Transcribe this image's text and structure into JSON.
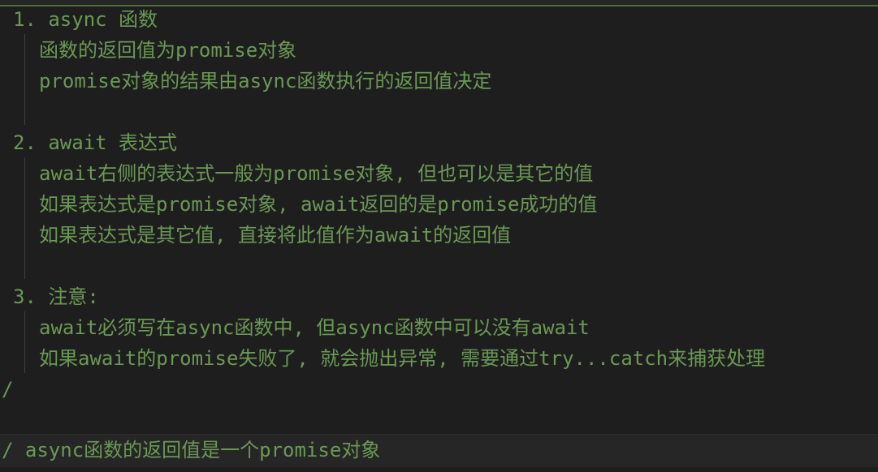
{
  "code": {
    "lines": [
      "1. async 函数",
      "函数的返回值为promise对象",
      "promise对象的结果由async函数执行的返回值决定",
      "2. await 表达式",
      "await右侧的表达式一般为promise对象, 但也可以是其它的值",
      "如果表达式是promise对象, await返回的是promise成功的值",
      "如果表达式是其它值, 直接将此值作为await的返回值",
      "3. 注意:",
      "await必须写在async函数中, 但async函数中可以没有await",
      "如果await的promise失败了, 就会抛出异常, 需要通过try...catch来捕获处理",
      "/",
      "/ async函数的返回值是一个promise对象"
    ]
  },
  "colors": {
    "background": "#1e1e1e",
    "comment": "#6a9955",
    "indent_guide": "#404040",
    "current_line": "#262626"
  }
}
